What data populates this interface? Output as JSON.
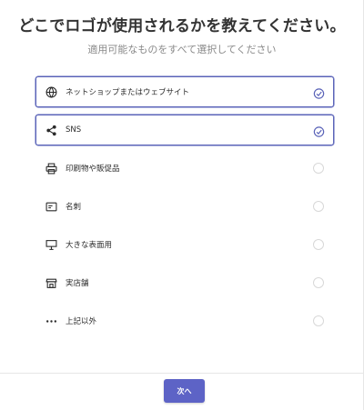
{
  "header": {
    "title": "どこでロゴが使用されるかを教えてください。",
    "subtitle": "適用可能なものをすべて選択してください"
  },
  "options": [
    {
      "label": "ネットショップまたはウェブサイト",
      "icon": "globe-icon",
      "selected": true
    },
    {
      "label": "SNS",
      "icon": "share-icon",
      "selected": true
    },
    {
      "label": "印刷物や販促品",
      "icon": "printer-icon",
      "selected": false
    },
    {
      "label": "名刺",
      "icon": "business-card-icon",
      "selected": false
    },
    {
      "label": "大きな表面用",
      "icon": "billboard-icon",
      "selected": false
    },
    {
      "label": "実店舗",
      "icon": "storefront-icon",
      "selected": false
    },
    {
      "label": "上記以外",
      "icon": "more-icon",
      "selected": false
    }
  ],
  "footer": {
    "next_label": "次へ"
  },
  "colors": {
    "accent": "#5d63c6",
    "selected_border": "#5a63b8"
  }
}
